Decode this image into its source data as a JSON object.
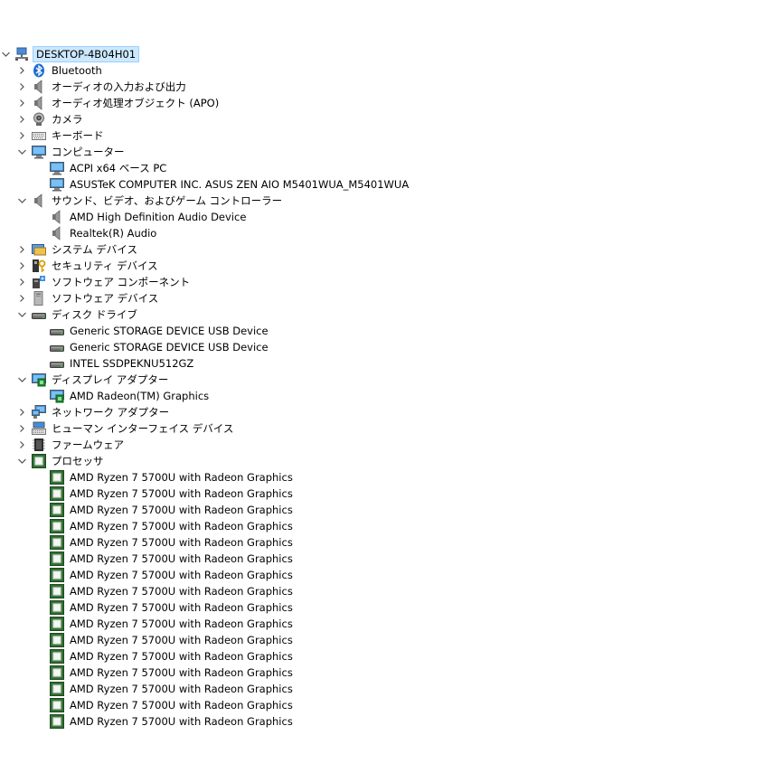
{
  "tree": {
    "root": {
      "label": "DESKTOP-4B04H01",
      "expanded": true,
      "icon": "computer-network-icon",
      "selected": true
    },
    "items": [
      {
        "label": "Bluetooth",
        "level": 1,
        "expandable": true,
        "expanded": false,
        "icon": "bluetooth-icon"
      },
      {
        "label": "オーディオの入力および出力",
        "level": 1,
        "expandable": true,
        "expanded": false,
        "icon": "speaker-icon"
      },
      {
        "label": "オーディオ処理オブジェクト (APO)",
        "level": 1,
        "expandable": true,
        "expanded": false,
        "icon": "speaker-icon"
      },
      {
        "label": "カメラ",
        "level": 1,
        "expandable": true,
        "expanded": false,
        "icon": "camera-icon"
      },
      {
        "label": "キーボード",
        "level": 1,
        "expandable": true,
        "expanded": false,
        "icon": "keyboard-icon"
      },
      {
        "label": "コンピューター",
        "level": 1,
        "expandable": true,
        "expanded": true,
        "icon": "monitor-icon"
      },
      {
        "label": "ACPI x64 ベース PC",
        "level": 2,
        "expandable": false,
        "icon": "monitor-icon"
      },
      {
        "label": "ASUSTeK COMPUTER INC. ASUS ZEN AIO M5401WUA_M5401WUA",
        "level": 2,
        "expandable": false,
        "icon": "monitor-icon"
      },
      {
        "label": "サウンド、ビデオ、およびゲーム コントローラー",
        "level": 1,
        "expandable": true,
        "expanded": true,
        "icon": "speaker-icon"
      },
      {
        "label": "AMD High Definition Audio Device",
        "level": 2,
        "expandable": false,
        "icon": "speaker-icon"
      },
      {
        "label": "Realtek(R) Audio",
        "level": 2,
        "expandable": false,
        "icon": "speaker-icon"
      },
      {
        "label": "システム デバイス",
        "level": 1,
        "expandable": true,
        "expanded": false,
        "icon": "system-folder-icon"
      },
      {
        "label": "セキュリティ デバイス",
        "level": 1,
        "expandable": true,
        "expanded": false,
        "icon": "security-key-icon"
      },
      {
        "label": "ソフトウェア コンポーネント",
        "level": 1,
        "expandable": true,
        "expanded": false,
        "icon": "software-component-icon"
      },
      {
        "label": "ソフトウェア デバイス",
        "level": 1,
        "expandable": true,
        "expanded": false,
        "icon": "software-device-icon"
      },
      {
        "label": "ディスク ドライブ",
        "level": 1,
        "expandable": true,
        "expanded": true,
        "icon": "disk-drive-icon"
      },
      {
        "label": "Generic STORAGE DEVICE USB Device",
        "level": 2,
        "expandable": false,
        "icon": "disk-drive-icon"
      },
      {
        "label": "Generic STORAGE DEVICE USB Device",
        "level": 2,
        "expandable": false,
        "icon": "disk-drive-icon"
      },
      {
        "label": "INTEL SSDPEKNU512GZ",
        "level": 2,
        "expandable": false,
        "icon": "disk-drive-icon"
      },
      {
        "label": "ディスプレイ アダプター",
        "level": 1,
        "expandable": true,
        "expanded": true,
        "icon": "display-adapter-icon"
      },
      {
        "label": "AMD Radeon(TM) Graphics",
        "level": 2,
        "expandable": false,
        "icon": "display-adapter-icon"
      },
      {
        "label": "ネットワーク アダプター",
        "level": 1,
        "expandable": true,
        "expanded": false,
        "icon": "network-adapter-icon"
      },
      {
        "label": "ヒューマン インターフェイス デバイス",
        "level": 1,
        "expandable": true,
        "expanded": false,
        "icon": "hid-icon"
      },
      {
        "label": "ファームウェア",
        "level": 1,
        "expandable": true,
        "expanded": false,
        "icon": "firmware-icon"
      },
      {
        "label": "プロセッサ",
        "level": 1,
        "expandable": true,
        "expanded": true,
        "icon": "processor-icon"
      },
      {
        "label": "AMD Ryzen 7 5700U with Radeon Graphics",
        "level": 2,
        "expandable": false,
        "icon": "processor-icon"
      },
      {
        "label": "AMD Ryzen 7 5700U with Radeon Graphics",
        "level": 2,
        "expandable": false,
        "icon": "processor-icon"
      },
      {
        "label": "AMD Ryzen 7 5700U with Radeon Graphics",
        "level": 2,
        "expandable": false,
        "icon": "processor-icon"
      },
      {
        "label": "AMD Ryzen 7 5700U with Radeon Graphics",
        "level": 2,
        "expandable": false,
        "icon": "processor-icon"
      },
      {
        "label": "AMD Ryzen 7 5700U with Radeon Graphics",
        "level": 2,
        "expandable": false,
        "icon": "processor-icon"
      },
      {
        "label": "AMD Ryzen 7 5700U with Radeon Graphics",
        "level": 2,
        "expandable": false,
        "icon": "processor-icon"
      },
      {
        "label": "AMD Ryzen 7 5700U with Radeon Graphics",
        "level": 2,
        "expandable": false,
        "icon": "processor-icon"
      },
      {
        "label": "AMD Ryzen 7 5700U with Radeon Graphics",
        "level": 2,
        "expandable": false,
        "icon": "processor-icon"
      },
      {
        "label": "AMD Ryzen 7 5700U with Radeon Graphics",
        "level": 2,
        "expandable": false,
        "icon": "processor-icon"
      },
      {
        "label": "AMD Ryzen 7 5700U with Radeon Graphics",
        "level": 2,
        "expandable": false,
        "icon": "processor-icon"
      },
      {
        "label": "AMD Ryzen 7 5700U with Radeon Graphics",
        "level": 2,
        "expandable": false,
        "icon": "processor-icon"
      },
      {
        "label": "AMD Ryzen 7 5700U with Radeon Graphics",
        "level": 2,
        "expandable": false,
        "icon": "processor-icon"
      },
      {
        "label": "AMD Ryzen 7 5700U with Radeon Graphics",
        "level": 2,
        "expandable": false,
        "icon": "processor-icon"
      },
      {
        "label": "AMD Ryzen 7 5700U with Radeon Graphics",
        "level": 2,
        "expandable": false,
        "icon": "processor-icon"
      },
      {
        "label": "AMD Ryzen 7 5700U with Radeon Graphics",
        "level": 2,
        "expandable": false,
        "icon": "processor-icon"
      },
      {
        "label": "AMD Ryzen 7 5700U with Radeon Graphics",
        "level": 2,
        "expandable": false,
        "icon": "processor-icon"
      }
    ]
  },
  "colors": {
    "selection_bg": "#cce8ff",
    "selection_border": "#99d1ff",
    "chevron": "#505050"
  }
}
